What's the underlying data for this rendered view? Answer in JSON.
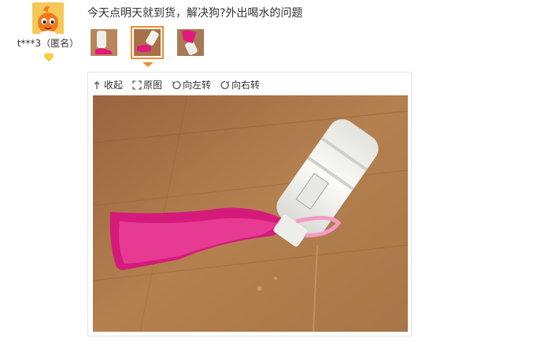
{
  "review": {
    "user_name": "t***3（匿名）",
    "comment": "今天点明天就到货，解决狗?外出喝水的问题"
  },
  "thumbnails": [
    {
      "alt": "photo-1",
      "selected": false
    },
    {
      "alt": "photo-2",
      "selected": true
    },
    {
      "alt": "photo-3",
      "selected": false
    }
  ],
  "toolbar": {
    "collapse_label": "收起",
    "original_label": "原图",
    "rotate_left_label": "向左转",
    "rotate_right_label": "向右转"
  },
  "colors": {
    "selected_border": "#f08d2e",
    "floor": "#b07a4a",
    "bowl": "#e0197e",
    "bottle": "#f1f1ee"
  }
}
